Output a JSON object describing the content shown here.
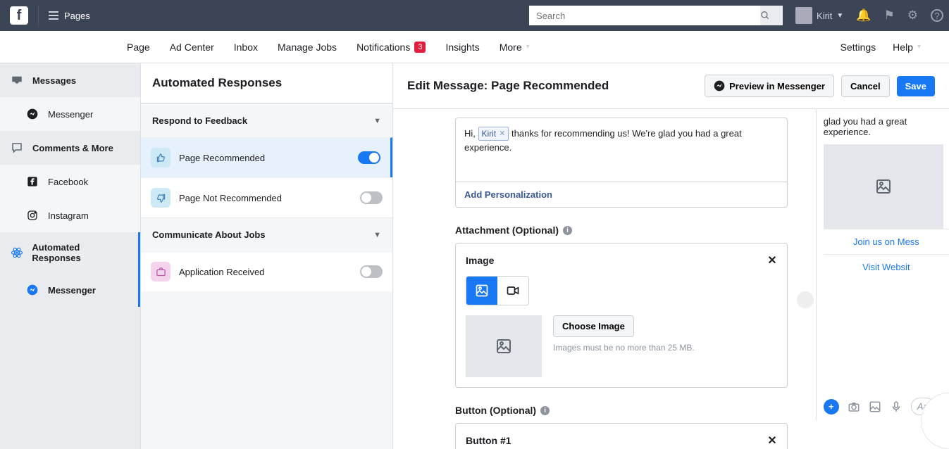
{
  "topbar": {
    "pages_label": "Pages",
    "search_placeholder": "Search",
    "username": "Kirit"
  },
  "pagenav": {
    "items": [
      "Page",
      "Ad Center",
      "Inbox",
      "Manage Jobs",
      "Notifications",
      "Insights",
      "More"
    ],
    "notifications_badge": "3",
    "settings": "Settings",
    "help": "Help"
  },
  "sidebar": {
    "messages": "Messages",
    "messenger1": "Messenger",
    "comments": "Comments & More",
    "facebook": "Facebook",
    "instagram": "Instagram",
    "automated": "Automated Responses",
    "messenger2": "Messenger"
  },
  "mid": {
    "header": "Automated Responses",
    "section_feedback": "Respond to Feedback",
    "item_recommended": "Page Recommended",
    "item_not_recommended": "Page Not Recommended",
    "section_jobs": "Communicate About Jobs",
    "item_application": "Application Received"
  },
  "editor": {
    "title": "Edit Message: Page Recommended",
    "preview_btn": "Preview in Messenger",
    "cancel_btn": "Cancel",
    "save_btn": "Save",
    "message_prefix": "Hi, ",
    "token_name": "Kirit",
    "message_suffix": " thanks for recommending us! We're glad you had a great experience.",
    "add_personalization": "Add Personalization",
    "attachment_label": "Attachment (Optional)",
    "attachment_card_title": "Image",
    "choose_image": "Choose Image",
    "image_hint": "Images must be no more than 25 MB.",
    "button_label": "Button (Optional)",
    "button_card_title": "Button #1"
  },
  "preview": {
    "line": "glad you had a great experience.",
    "cta1": "Join us on Mess",
    "cta2": "Visit Websit",
    "composer_placeholder": "Aa"
  }
}
